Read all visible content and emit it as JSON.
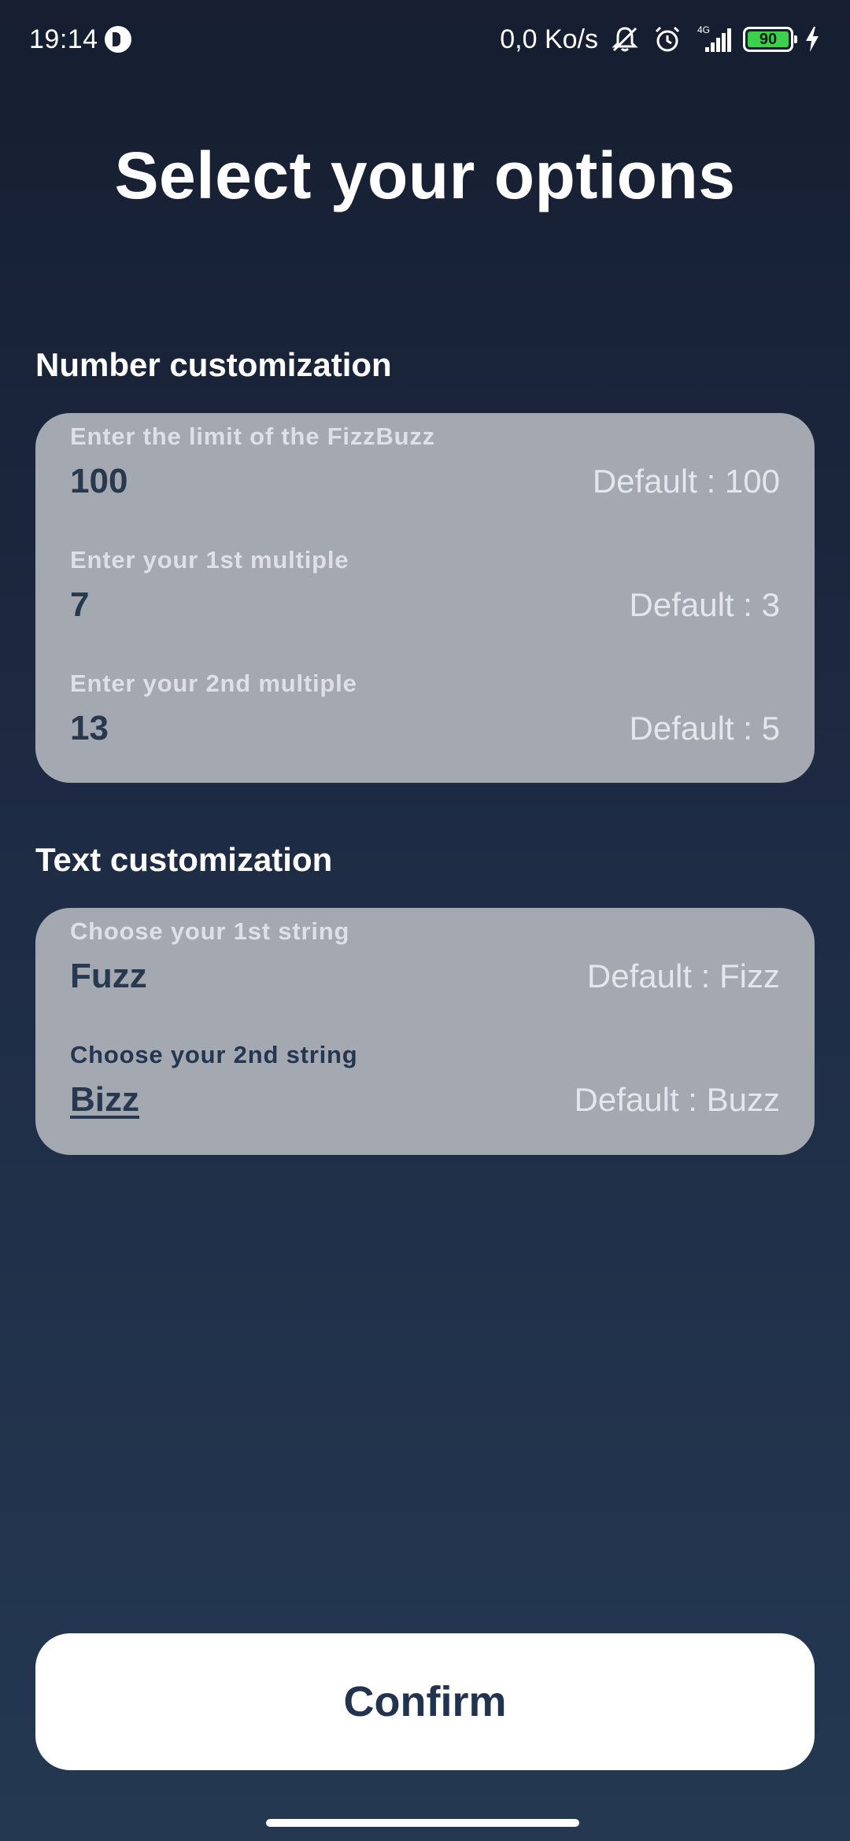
{
  "status_bar": {
    "time": "19:14",
    "net_speed": "0,0 Ko/s",
    "network_type": "4G",
    "battery_level": "90",
    "icons": [
      "p-circle-icon",
      "mute-bell-icon",
      "alarm-icon",
      "signal-icon",
      "battery-icon",
      "charging-bolt-icon"
    ]
  },
  "title": "Select your options",
  "number_section": {
    "heading": "Number customization",
    "fields": [
      {
        "label": "Enter the limit of the FizzBuzz",
        "value": "100",
        "default": "Default : 100"
      },
      {
        "label": "Enter your 1st multiple",
        "value": "7",
        "default": "Default : 3"
      },
      {
        "label": "Enter your 2nd multiple",
        "value": "13",
        "default": "Default : 5"
      }
    ]
  },
  "text_section": {
    "heading": "Text customization",
    "fields": [
      {
        "label": "Choose your 1st string",
        "value": "Fuzz",
        "default": "Default : Fizz"
      },
      {
        "label": "Choose your 2nd string",
        "value": "Bizz",
        "default": "Default : Buzz"
      }
    ]
  },
  "confirm_label": "Confirm",
  "colors": {
    "background_top": "#161e30",
    "background_bottom": "#243852",
    "card": "#a3a8b1",
    "value_text": "#27384f",
    "button": "#ffffff",
    "battery_fill": "#3bd14a"
  }
}
